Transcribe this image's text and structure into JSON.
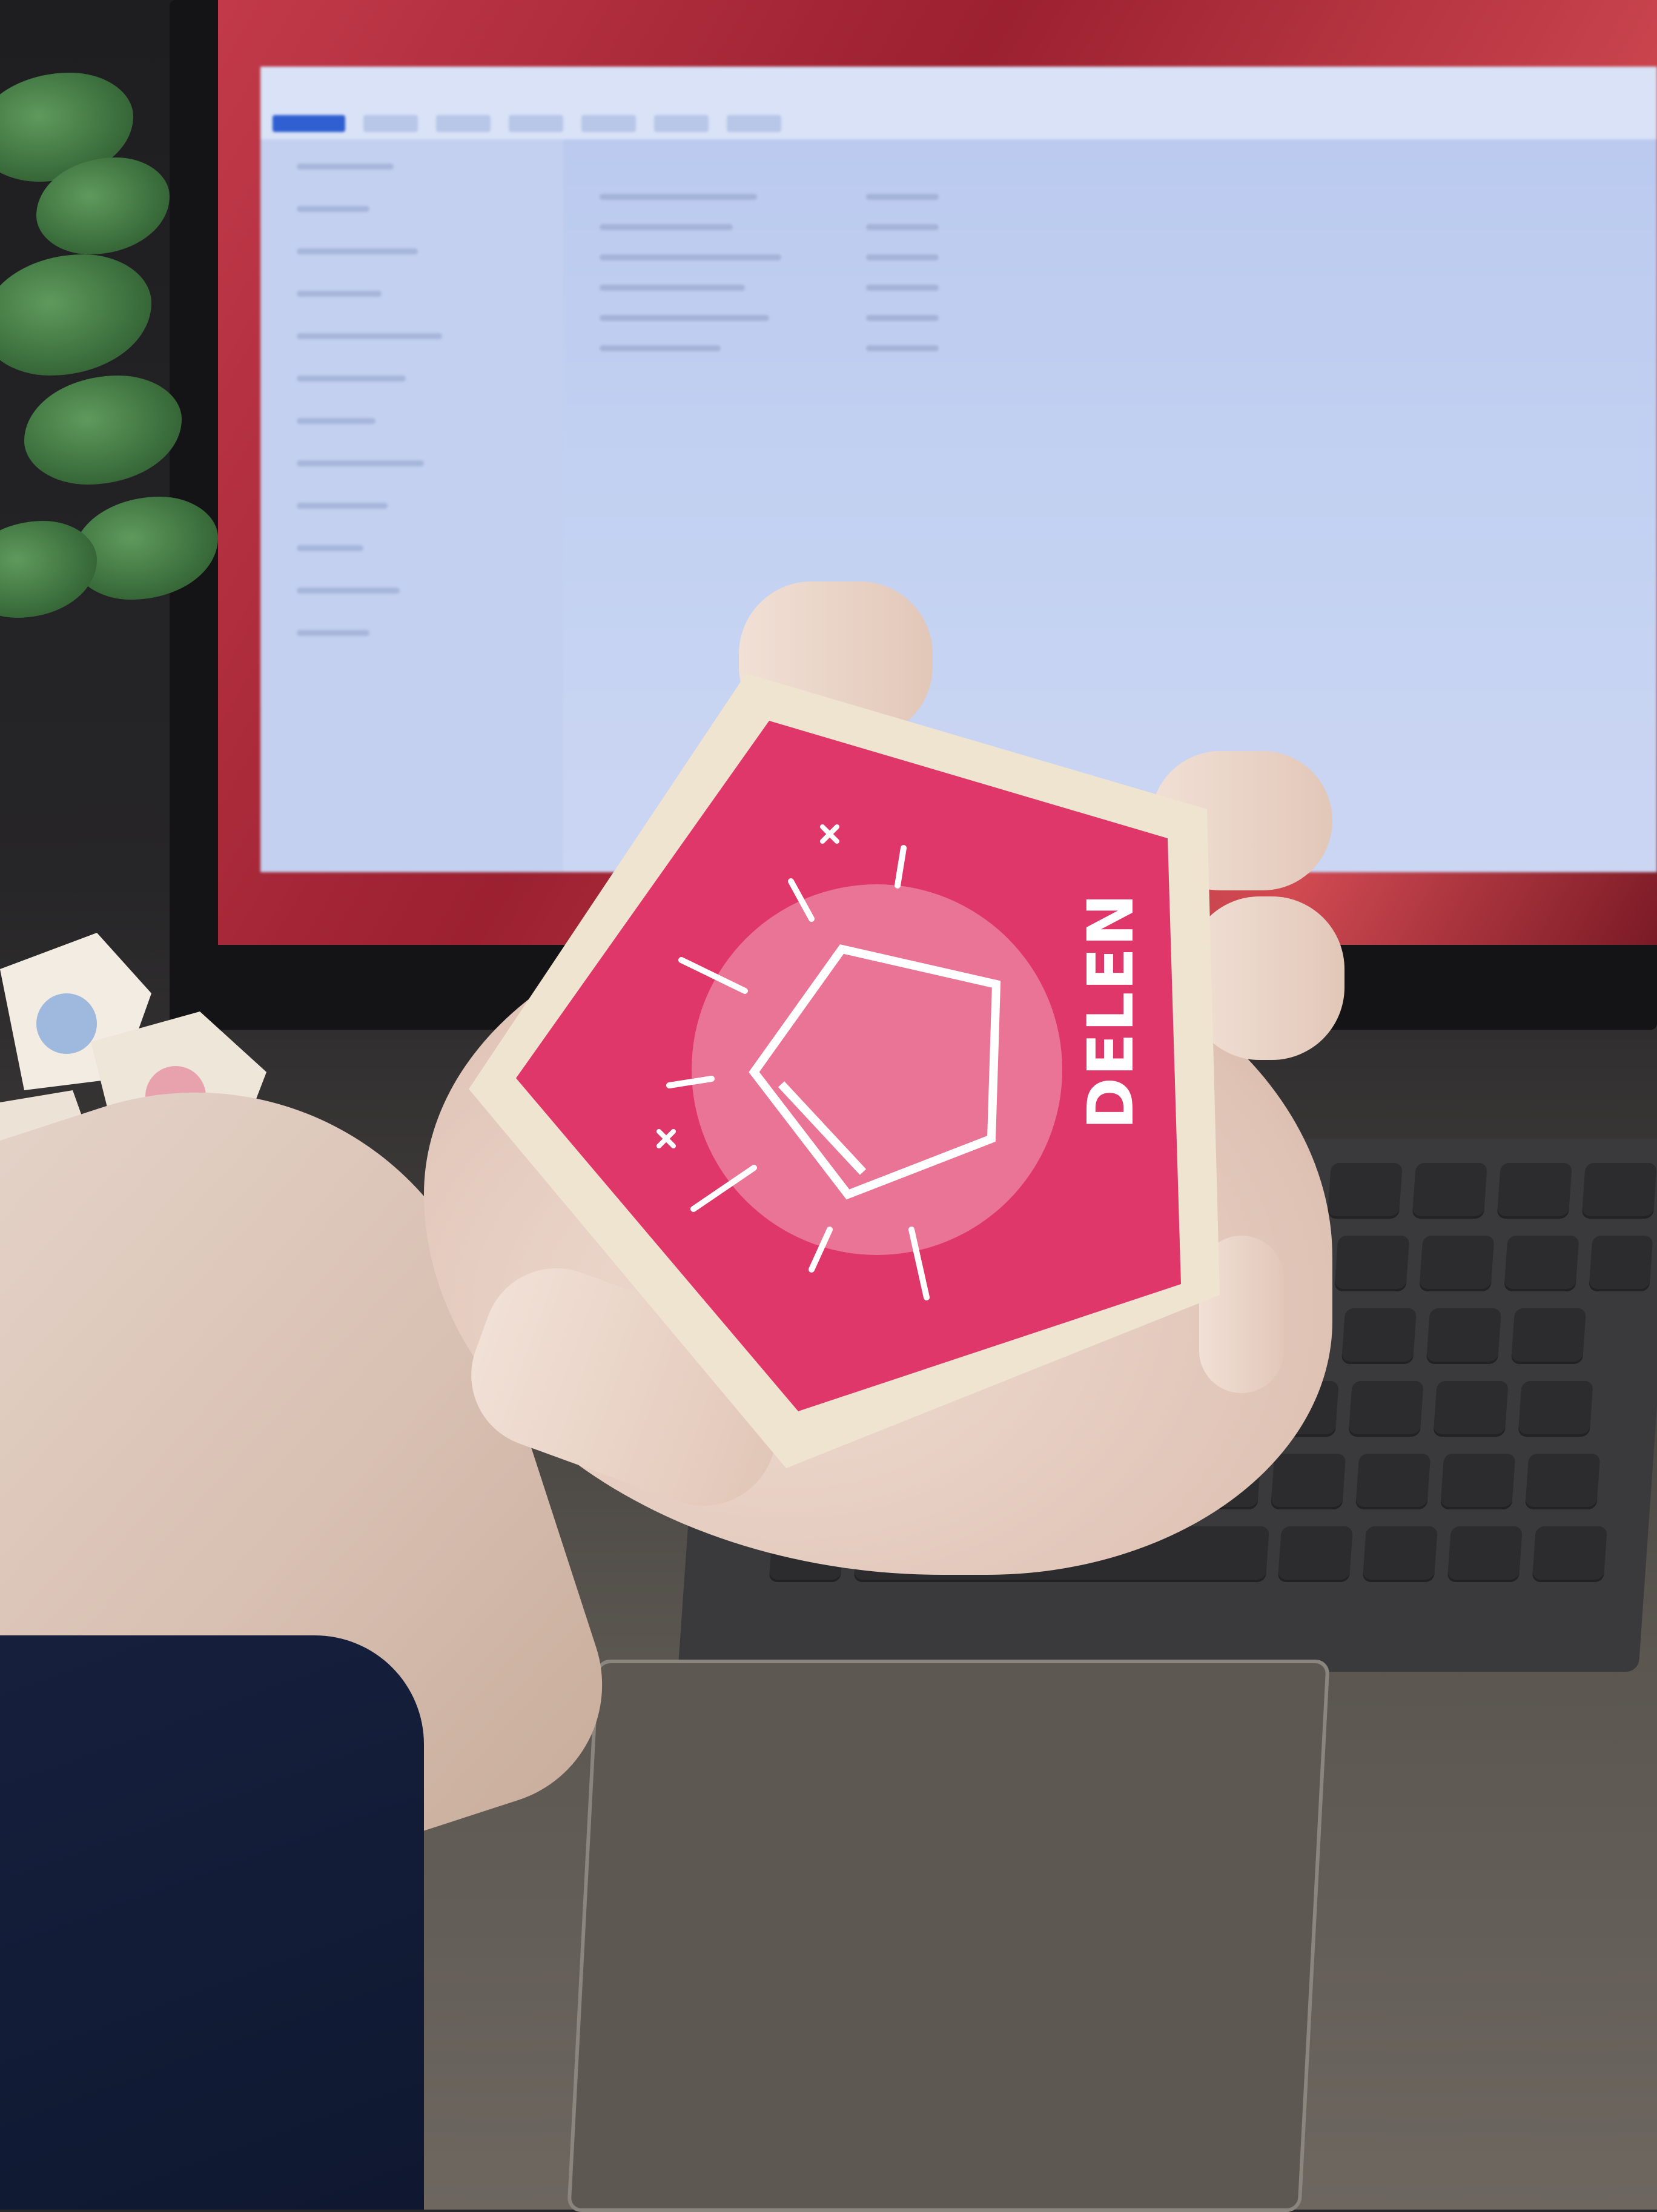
{
  "scene": {
    "description_tags": [
      "hand",
      "wooden-tile",
      "laptop",
      "plant"
    ]
  },
  "card": {
    "label": "DELEN",
    "icon": "cyclopentene-icon",
    "colors": {
      "face": "#e0376a",
      "border": "#efe4cf",
      "halo": "#ee8aa4",
      "line": "#ffffff"
    }
  }
}
